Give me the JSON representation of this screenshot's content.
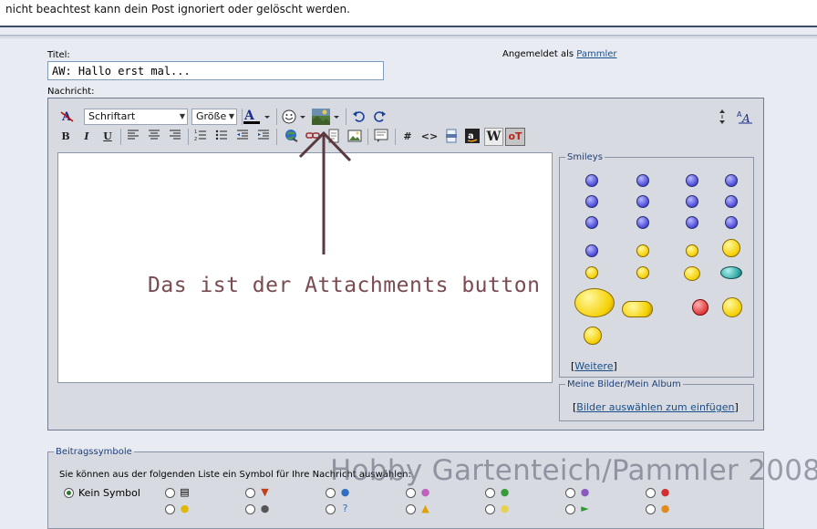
{
  "top_notice": "nicht beachtest kann dein Post ignoriert oder gelöscht werden.",
  "form": {
    "title_label": "Titel:",
    "title_value": "AW: Hallo erst mal...",
    "message_label": "Nachricht:",
    "logged_in_prefix": "Angemeldet als",
    "logged_in_user": "Pammler"
  },
  "toolbar": {
    "font_dropdown": "Schriftart",
    "size_dropdown": "Größe",
    "bold": "B",
    "italic": "I",
    "underline": "U",
    "hash": "#",
    "code": "<>",
    "wiki": "W",
    "offtopic": "oT"
  },
  "editor": {
    "annotation_text": "Das ist der Attachments button"
  },
  "smileys": {
    "legend": "Smileys",
    "more_open": "[",
    "more_link": "Weitere",
    "more_close": "]"
  },
  "album": {
    "legend": "Meine Bilder/Mein Album",
    "open": "[",
    "link": "Bilder auswählen zum einfügen",
    "close": "]"
  },
  "post_icons": {
    "legend": "Beitragssymbole",
    "instruction": "Sie können aus der folgenden Liste ein Symbol für Ihre Nachricht auswählen:",
    "no_symbol": "Kein Symbol"
  },
  "watermark": "Hobby Gartenteich/Pammler 2008",
  "colors": {
    "accent_link": "#1a4f8a",
    "annotation": "#7a4b50",
    "editor_bg": "#d7dae0"
  }
}
